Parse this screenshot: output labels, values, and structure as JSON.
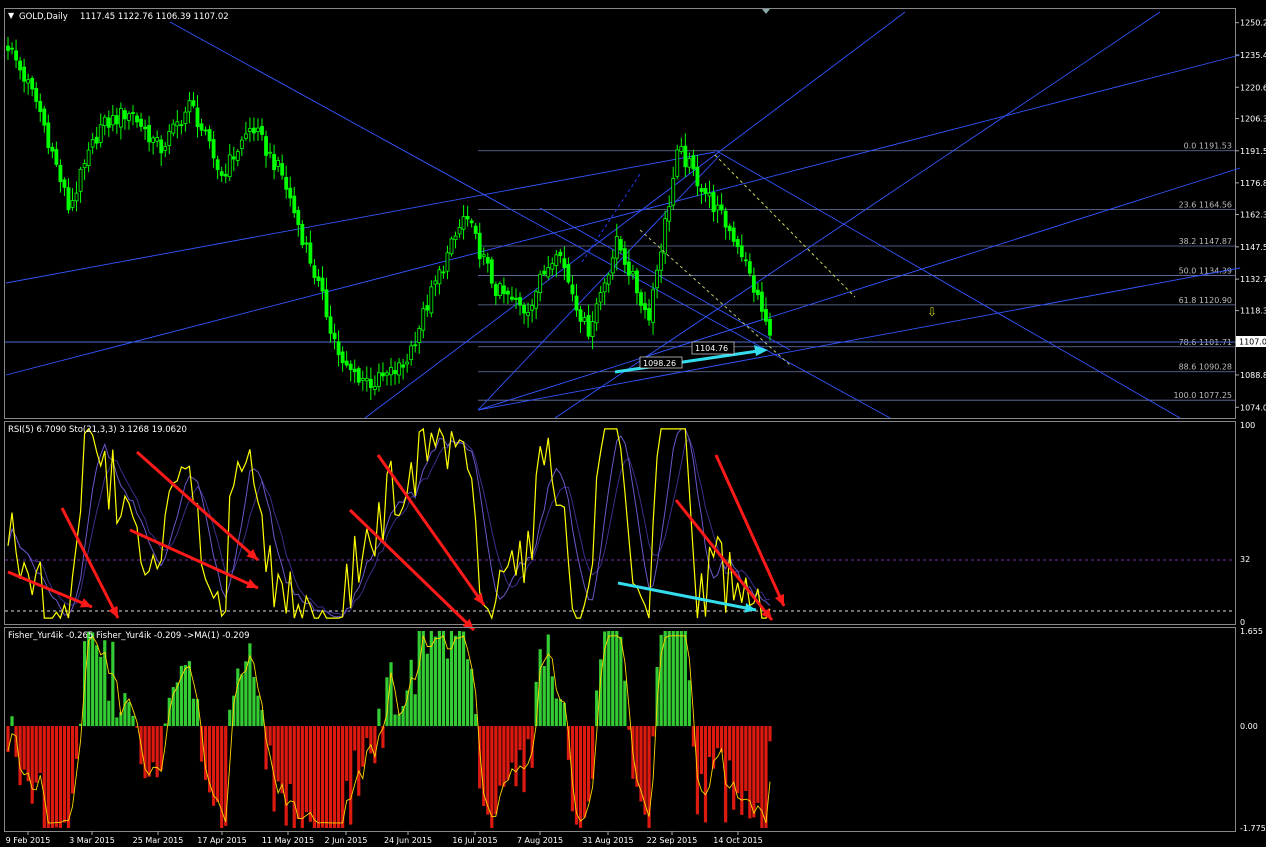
{
  "main_panel": {
    "symbol": "GOLD,Daily",
    "ohlc": "1117.45 1122.76 1106.39 1107.02",
    "current_price": "1107.0",
    "y_ticks": [
      "1250.2",
      "1235.4",
      "1220.6",
      "1206.3",
      "1191.5",
      "1176.8",
      "1162.3",
      "1147.5",
      "1132.7",
      "1118.3",
      "1103.6",
      "1088.8",
      "1074.0"
    ],
    "fib_levels": [
      {
        "label": "0.0",
        "value": "1191.53"
      },
      {
        "label": "23.6",
        "value": "1164.56"
      },
      {
        "label": "38.2",
        "value": "1147.87"
      },
      {
        "label": "50.0",
        "value": "1134.39"
      },
      {
        "label": "61.8",
        "value": "1120.90"
      },
      {
        "label": "78.6",
        "value": "1101.71"
      },
      {
        "label": "88.6",
        "value": "1090.28"
      },
      {
        "label": "100.0",
        "value": "1077.25"
      }
    ],
    "annotation_low1": "1098.26",
    "annotation_low2": "1104.76"
  },
  "rsi_panel": {
    "title": "RSI(5) 6.7090   Sto(21,3,3) 3.1268 19.0620",
    "y_ticks": [
      "100",
      "32",
      "0"
    ]
  },
  "fisher_panel": {
    "title": "Fisher_Yur4ik -0.265  Fisher_Yur4ik -0.209  ->MA(1) -0.209",
    "y_ticks": [
      "1.655",
      "0.00",
      "-1.775"
    ]
  },
  "x_axis": {
    "labels": [
      "9 Feb 2015",
      "3 Mar 2015",
      "25 Mar 2015",
      "17 Apr 2015",
      "11 May 2015",
      "2 Jun 2015",
      "24 Jun 2015",
      "16 Jul 2015",
      "7 Aug 2015",
      "31 Aug 2015",
      "22 Sep 2015",
      "14 Oct 2015"
    ]
  },
  "colors": {
    "background": "#000000",
    "bull": "#00ff00",
    "bear": "#00ff00",
    "trendline": "#3355ff",
    "fib": "#6b7aa8",
    "rsi": "#ffff00",
    "stoch": "#5a4ab8",
    "arrow_red": "#ff1a1a",
    "arrow_cyan": "#33ddee",
    "hist_pos": "#33cc33",
    "hist_neg": "#dd1a10",
    "fisher_line": "#ffd700"
  },
  "chart_data": [
    {
      "type": "candlestick",
      "title": "GOLD,Daily",
      "ylim": [
        1070,
        1256
      ],
      "x": [
        "9 Feb 2015",
        "3 Mar 2015",
        "25 Mar 2015",
        "17 Apr 2015",
        "11 May 2015",
        "2 Jun 2015",
        "24 Jun 2015",
        "16 Jul 2015",
        "7 Aug 2015",
        "31 Aug 2015",
        "22 Sep 2015",
        "14 Oct 2015"
      ],
      "close_anchors": [
        1240,
        1212,
        1165,
        1202,
        1210,
        1192,
        1213,
        1180,
        1203,
        1180,
        1138,
        1092,
        1085,
        1093,
        1130,
        1162,
        1128,
        1118,
        1148,
        1108,
        1150,
        1115,
        1192,
        1170,
        1148,
        1107
      ],
      "fib_levels": [
        1191.53,
        1164.56,
        1147.87,
        1134.39,
        1120.9,
        1101.71,
        1090.28,
        1077.25
      ],
      "annotations": [
        1098.26,
        1104.76
      ],
      "last": 1107.02
    },
    {
      "type": "line",
      "title": "RSI(5) / Sto(21,3,3)",
      "ylim": [
        0,
        100
      ],
      "levels": [
        32,
        3
      ],
      "series": [
        {
          "name": "RSI(5)",
          "last": 6.709
        },
        {
          "name": "Sto(21,3,3)",
          "last": [
            3.1268,
            19.062
          ]
        }
      ]
    },
    {
      "type": "bar",
      "title": "Fisher_Yur4ik",
      "ylim": [
        -1.775,
        1.655
      ],
      "series": [
        {
          "name": "Fisher_Yur4ik",
          "last": -0.265
        },
        {
          "name": "->MA(1)",
          "last": -0.209
        }
      ]
    }
  ]
}
